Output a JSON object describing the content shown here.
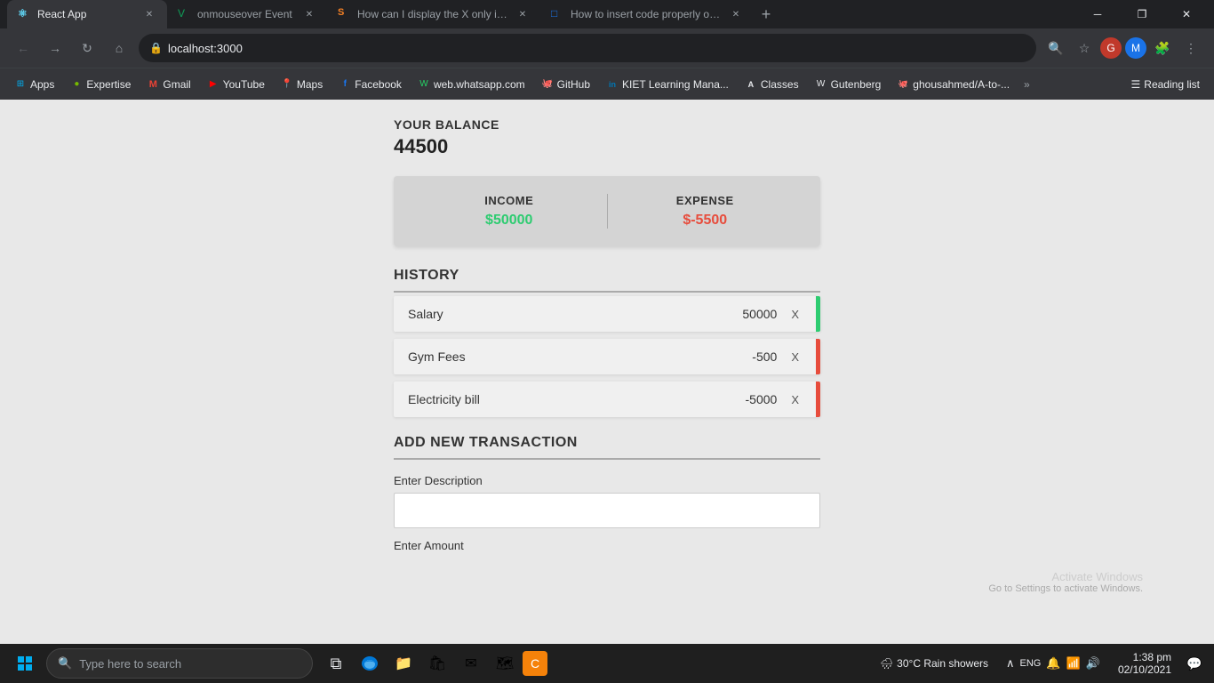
{
  "browser": {
    "tabs": [
      {
        "id": "tab-react",
        "title": "React App",
        "favicon": "⚛",
        "favicon_color": "react",
        "active": true
      },
      {
        "id": "tab-onmouse",
        "title": "onmouseover Event",
        "favicon": "V",
        "favicon_color": "green",
        "active": false
      },
      {
        "id": "tab-stackoverflow1",
        "title": "How can I display the X only in si",
        "favicon": "S",
        "favicon_color": "stackoverflow",
        "active": false
      },
      {
        "id": "tab-stackoverflow2",
        "title": "How to insert code properly on S",
        "favicon": "□",
        "favicon_color": "blue",
        "active": false
      }
    ],
    "address": "localhost:3000",
    "bookmarks": [
      {
        "label": "Apps",
        "icon": "⊞"
      },
      {
        "label": "Expertise",
        "icon": "●"
      },
      {
        "label": "Gmail",
        "icon": "M"
      },
      {
        "label": "YouTube",
        "icon": "▶"
      },
      {
        "label": "Maps",
        "icon": "📍"
      },
      {
        "label": "Facebook",
        "icon": "f"
      },
      {
        "label": "web.whatsapp.com",
        "icon": "W"
      },
      {
        "label": "GitHub",
        "icon": "🐙"
      },
      {
        "label": "KIET Learning Mana...",
        "icon": "in"
      },
      {
        "label": "Classes",
        "icon": "A"
      },
      {
        "label": "Gutenberg",
        "icon": "W"
      },
      {
        "label": "ghousahmed/A-to-...",
        "icon": "🐙"
      }
    ],
    "reading_list": "Reading list"
  },
  "app": {
    "balance_label": "YOUR BALANCE",
    "balance_amount": "44500",
    "income_label": "INCOME",
    "income_amount": "$50000",
    "expense_label": "EXPENSE",
    "expense_amount": "$-5500",
    "history_label": "HISTORY",
    "transactions": [
      {
        "id": 1,
        "name": "Salary",
        "amount": "50000",
        "type": "income"
      },
      {
        "id": 2,
        "name": "Gym Fees",
        "amount": "-500",
        "type": "expense"
      },
      {
        "id": 3,
        "name": "Electricity bill",
        "amount": "-5000",
        "type": "expense"
      }
    ],
    "add_transaction_label": "ADD NEW TRANSACTION",
    "description_label": "Enter Description",
    "amount_label": "Enter Amount",
    "description_placeholder": "",
    "amount_placeholder": ""
  },
  "activate_windows": {
    "title": "Activate Windows",
    "subtitle": "Go to Settings to activate Windows."
  },
  "taskbar": {
    "search_placeholder": "Type here to search",
    "time": "1:38 pm",
    "date": "02/10/2021",
    "weather": "30°C  Rain showers",
    "taskbar_icons": [
      {
        "name": "task-view",
        "icon": "⧉"
      },
      {
        "name": "edge-browser",
        "icon": "🌐"
      },
      {
        "name": "file-explorer",
        "icon": "📁"
      },
      {
        "name": "microsoft-store",
        "icon": "🛍"
      },
      {
        "name": "mail",
        "icon": "✉"
      },
      {
        "name": "maps-app",
        "icon": "🗺"
      },
      {
        "name": "app-orange",
        "icon": "🔶"
      }
    ]
  }
}
